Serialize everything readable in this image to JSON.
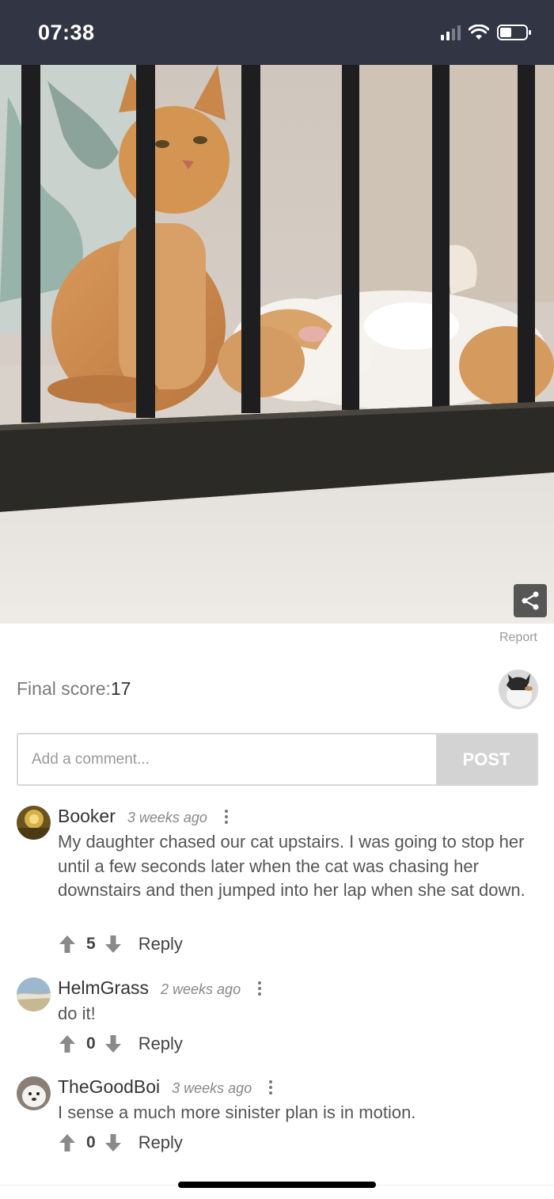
{
  "status_bar": {
    "time": "07:38",
    "icons": [
      "cellular-signal-icon",
      "wifi-icon",
      "battery-icon"
    ]
  },
  "post": {
    "photo_alt": "",
    "report_label": "Report",
    "final_score_label": "Final score:",
    "final_score_value": "17"
  },
  "comment_form": {
    "placeholder": "Add a comment...",
    "post_label": "POST"
  },
  "comments": [
    {
      "author": "Booker",
      "time": "3 weeks ago",
      "text": "My daughter chased our cat upstairs. I was going to stop her until a few seconds later when the cat was chasing her downstairs and then jumped into her lap when she sat down.",
      "votes": "5",
      "reply_label": "Reply"
    },
    {
      "author": "HelmGrass",
      "time": "2 weeks ago",
      "text": "do it!",
      "votes": "0",
      "reply_label": "Reply"
    },
    {
      "author": "TheGoodBoi",
      "time": "3 weeks ago",
      "text": "I sense a much more sinister plan is in motion.",
      "votes": "0",
      "reply_label": "Reply"
    }
  ],
  "colors": {
    "status_bar_bg": "#323543",
    "post_button_bg": "#d3d3d3",
    "vote_icon": "#8a8a8a"
  }
}
